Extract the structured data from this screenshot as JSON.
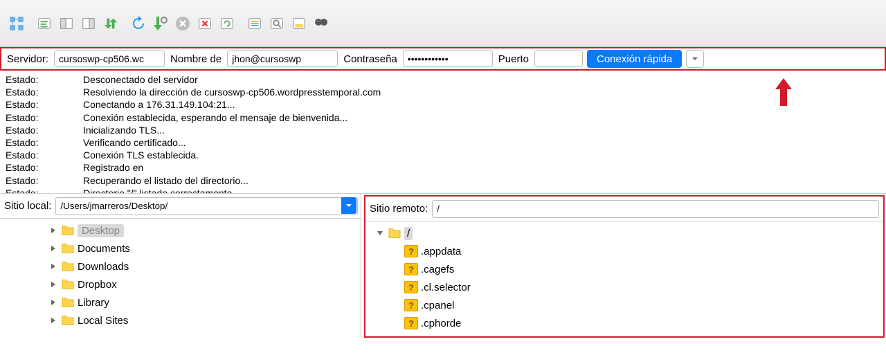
{
  "quickconnect": {
    "server_label": "Servidor:",
    "server_value": "cursoswp-cp506.wc",
    "user_label": "Nombre de",
    "user_value": "jhon@cursoswp",
    "pass_label": "Contraseña",
    "pass_value": "••••••••••••",
    "port_label": "Puerto",
    "port_value": "",
    "connect_label": "Conexión rápida"
  },
  "log": [
    {
      "tag": "Estado:",
      "msg": "Desconectado del servidor"
    },
    {
      "tag": "Estado:",
      "msg": "Resolviendo la dirección de cursoswp-cp506.wordpresstemporal.com"
    },
    {
      "tag": "Estado:",
      "msg": "Conectando a 176.31.149.104:21..."
    },
    {
      "tag": "Estado:",
      "msg": "Conexión establecida, esperando el mensaje de bienvenida..."
    },
    {
      "tag": "Estado:",
      "msg": "Inicializando TLS..."
    },
    {
      "tag": "Estado:",
      "msg": "Verificando certificado..."
    },
    {
      "tag": "Estado:",
      "msg": "Conexión TLS establecida."
    },
    {
      "tag": "Estado:",
      "msg": "Registrado en"
    },
    {
      "tag": "Estado:",
      "msg": "Recuperando el listado del directorio..."
    },
    {
      "tag": "Estado:",
      "msg": "Directorio \"/\" listado correctamente"
    }
  ],
  "local": {
    "label": "Sitio local:",
    "path": "/Users/jmarreros/Desktop/",
    "items": [
      {
        "name": "Desktop",
        "selected": true
      },
      {
        "name": "Documents"
      },
      {
        "name": "Downloads"
      },
      {
        "name": "Dropbox"
      },
      {
        "name": "Library"
      },
      {
        "name": "Local Sites"
      }
    ]
  },
  "remote": {
    "label": "Sitio remoto:",
    "path": "/",
    "root": "/",
    "items": [
      {
        "name": ".appdata"
      },
      {
        "name": ".cagefs"
      },
      {
        "name": ".cl.selector"
      },
      {
        "name": ".cpanel"
      },
      {
        "name": ".cphorde"
      }
    ]
  }
}
